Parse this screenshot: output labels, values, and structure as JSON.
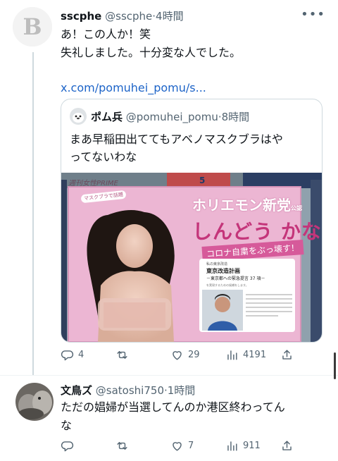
{
  "tweets": [
    {
      "display_name": "sscphe",
      "handle": "@sscphe",
      "time": "4時間",
      "text_line1": "あ！この人か！笑",
      "text_line2": "失礼しました。十分変な人でした。",
      "link": "x.com/pomuhei_pomu/s...",
      "quote": {
        "display_name": "ポム兵",
        "handle": "@pomuhei_pomu",
        "time": "8時間",
        "text_line1": "まあ早稲田出ててもアベノマスクブラはや",
        "text_line2": "ってないわな",
        "image": {
          "tag": "週刊女性PRIME",
          "number": "5",
          "badge": "マスクブラで話題",
          "title_line1": "ホリエモン新党",
          "title_suffix": "公認",
          "title_line2": "しんどう かな",
          "slogan": "コロナ自粛をぶっ壊す！",
          "box_label": "私の東京改造",
          "box_title": "東京改造計画",
          "box_subtitle": "－東京都への緊急提言 37 項－",
          "box_note": "を実現するための候補をします。"
        }
      },
      "stats": {
        "replies": "4",
        "retweets": "",
        "likes": "29",
        "views": "4191"
      }
    },
    {
      "display_name": "文鳥ズ",
      "handle": "@satoshi750",
      "time": "1時間",
      "text_line1": "ただの娼婦が当選してんのか港区終わってん",
      "text_line2": "な",
      "stats": {
        "replies": "",
        "retweets": "",
        "likes": "7",
        "views": "911"
      }
    }
  ],
  "meta_separator": "·",
  "icons": [
    "more-icon",
    "reply-icon",
    "retweet-icon",
    "like-icon",
    "views-icon",
    "share-icon"
  ],
  "colors": {
    "link": "#1d64c8",
    "muted": "#536471",
    "accent_pink": "#e7a3c8"
  }
}
